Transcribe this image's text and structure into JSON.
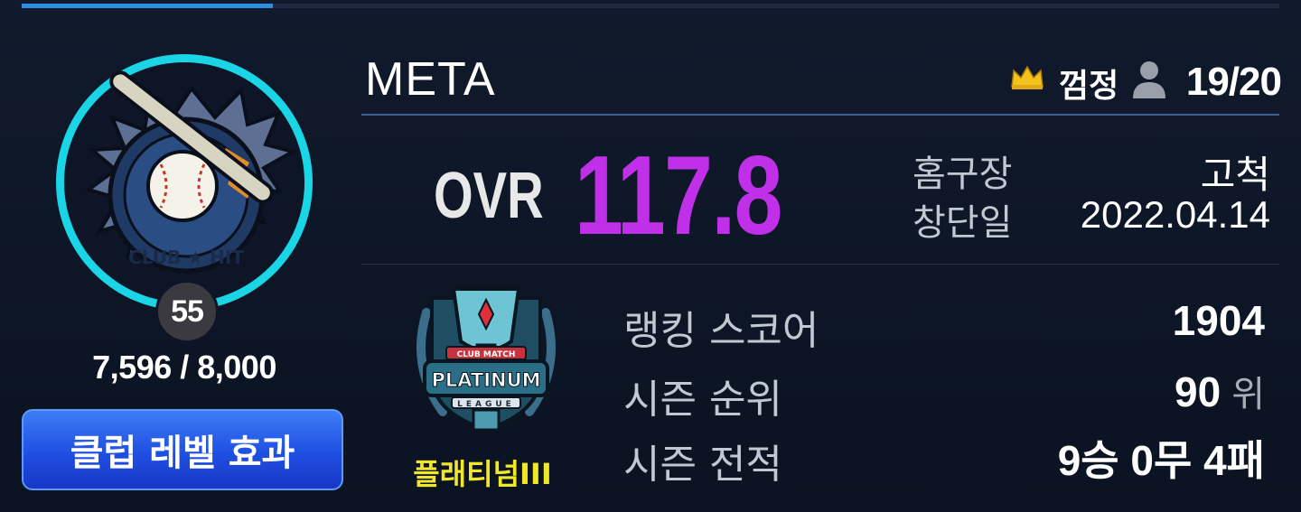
{
  "top_progress": 0.2,
  "club": {
    "name": "META",
    "master_name": "껌정",
    "member_count": "19/20",
    "level": "55",
    "exp_text": "7,596 / 8,000",
    "level_button_label": "클럽 레벨 효과",
    "emblem_text": "CLUB ★ HIT"
  },
  "ovr": {
    "label": "OVR",
    "value": "117.8"
  },
  "info": {
    "home_label": "홈구장",
    "home_value": "고척",
    "founded_label": "창단일",
    "founded_value": "2022.04.14"
  },
  "tier": {
    "badge_top": "CLUB MATCH",
    "badge_main": "PLATINUM",
    "badge_sub": "LEAGUE",
    "label": "플래티넘III"
  },
  "stats": {
    "ranking_label": "랭킹 스코어",
    "ranking_value": "1904",
    "season_rank_label": "시즌 순위",
    "season_rank_value": "90",
    "season_rank_unit": "위",
    "season_record_label": "시즌 전적",
    "season_record_value": "9승 0무 4패"
  },
  "colors": {
    "ovr": "#c030e8",
    "ring": "#19d5e6",
    "tier_label": "#f0e62a",
    "button": "#2a5cec"
  },
  "icons": [
    "crown-icon",
    "person-icon"
  ]
}
